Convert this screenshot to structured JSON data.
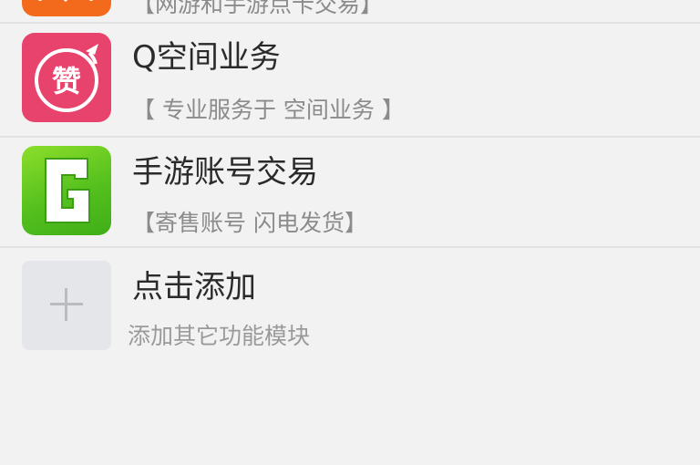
{
  "list": {
    "items": [
      {
        "subtitle": "【网游和手游点卡交易】",
        "icon": "orange-partial-app-icon"
      },
      {
        "title": "Q空间业务",
        "subtitle": "【 专业服务于 空间业务 】",
        "icon": "zan-like-icon",
        "icon_text": "赞"
      },
      {
        "title": "手游账号交易",
        "subtitle": "【寄售账号 闪电发货】",
        "icon": "green-g-icon"
      }
    ],
    "add_item": {
      "title": "点击添加",
      "subtitle": "添加其它功能模块",
      "icon": "plus-icon"
    }
  },
  "colors": {
    "background": "#f2f2f2",
    "zan_icon_bg": "#e8436c",
    "game_icon_bg": "#55c01e",
    "partial_icon_bg": "#f46a1c",
    "add_icon_bg": "#e4e6e9"
  }
}
